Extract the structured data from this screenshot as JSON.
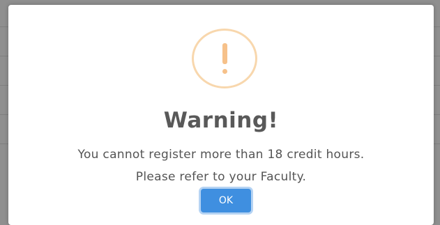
{
  "dialog": {
    "icon": "exclamation-icon",
    "title": "Warning!",
    "message_line1": "You cannot register more than 18 credit hours.",
    "message_line2": "Please refer to your Faculty.",
    "ok_label": "OK"
  },
  "colors": {
    "accent": "#3f8fe0",
    "warning": "#f6c18a",
    "overlay": "#8f8f8f"
  }
}
